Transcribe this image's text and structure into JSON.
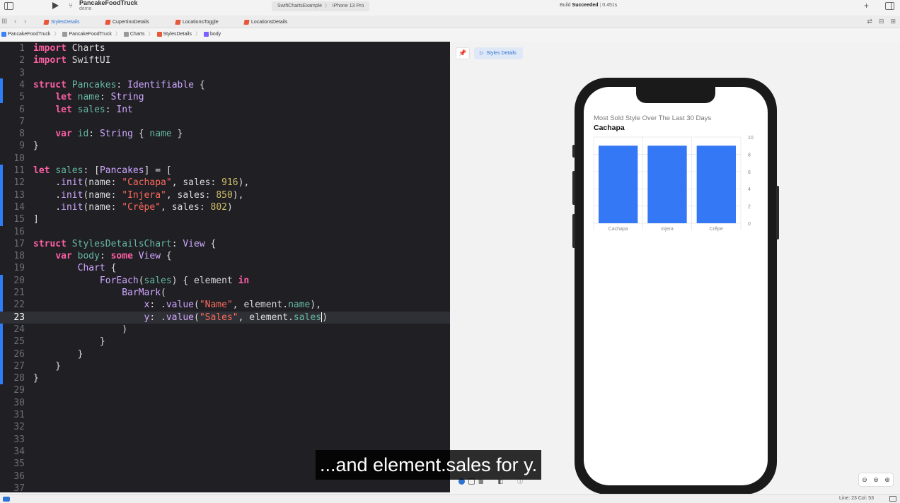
{
  "titlebar": {
    "project": "PancakeFoodTruck",
    "branch": "demo",
    "scheme": "SwiftChartsExample",
    "device": "iPhone 13 Pro",
    "build_status_prefix": "Build",
    "build_status": "Succeeded",
    "build_time": "0.451s"
  },
  "tabs": [
    {
      "label": "StylesDetails",
      "active": true
    },
    {
      "label": "CupertinoDetails",
      "active": false
    },
    {
      "label": "LocationsToggle",
      "active": false
    },
    {
      "label": "LocationsDetails",
      "active": false
    }
  ],
  "breadcrumb": [
    "PancakeFoodTruck",
    "PancakeFoodTruck",
    "Charts",
    "StylesDetails",
    "body"
  ],
  "editor": {
    "current_line": 23,
    "lines": [
      [
        [
          "kw",
          "import"
        ],
        [
          "pl",
          " Charts"
        ]
      ],
      [
        [
          "kw",
          "import"
        ],
        [
          "pl",
          " SwiftUI"
        ]
      ],
      [],
      [
        [
          "kw",
          "struct"
        ],
        [
          "pl",
          " "
        ],
        [
          "nm",
          "Pancakes"
        ],
        [
          "pl",
          ": "
        ],
        [
          "ty",
          "Identifiable"
        ],
        [
          "pl",
          " {"
        ]
      ],
      [
        [
          "pl",
          "    "
        ],
        [
          "kw",
          "let"
        ],
        [
          "pl",
          " "
        ],
        [
          "nm",
          "name"
        ],
        [
          "pl",
          ": "
        ],
        [
          "ty",
          "String"
        ]
      ],
      [
        [
          "pl",
          "    "
        ],
        [
          "kw",
          "let"
        ],
        [
          "pl",
          " "
        ],
        [
          "nm",
          "sales"
        ],
        [
          "pl",
          ": "
        ],
        [
          "ty",
          "Int"
        ]
      ],
      [],
      [
        [
          "pl",
          "    "
        ],
        [
          "kw",
          "var"
        ],
        [
          "pl",
          " "
        ],
        [
          "nm",
          "id"
        ],
        [
          "pl",
          ": "
        ],
        [
          "ty",
          "String"
        ],
        [
          "pl",
          " { "
        ],
        [
          "nm",
          "name"
        ],
        [
          "pl",
          " }"
        ]
      ],
      [
        [
          "pl",
          "}"
        ]
      ],
      [],
      [
        [
          "kw",
          "let"
        ],
        [
          "pl",
          " "
        ],
        [
          "nm",
          "sales"
        ],
        [
          "pl",
          ": ["
        ],
        [
          "ty",
          "Pancakes"
        ],
        [
          "pl",
          "] = ["
        ]
      ],
      [
        [
          "pl",
          "    ."
        ],
        [
          "ty",
          "init"
        ],
        [
          "pl",
          "(name: "
        ],
        [
          "st",
          "\"Cachapa\""
        ],
        [
          "pl",
          ", sales: "
        ],
        [
          "nu",
          "916"
        ],
        [
          "pl",
          "),"
        ]
      ],
      [
        [
          "pl",
          "    ."
        ],
        [
          "ty",
          "init"
        ],
        [
          "pl",
          "(name: "
        ],
        [
          "st",
          "\"Injera\""
        ],
        [
          "pl",
          ", sales: "
        ],
        [
          "nu",
          "850"
        ],
        [
          "pl",
          "),"
        ]
      ],
      [
        [
          "pl",
          "    ."
        ],
        [
          "ty",
          "init"
        ],
        [
          "pl",
          "(name: "
        ],
        [
          "st",
          "\"Crêpe\""
        ],
        [
          "pl",
          ", sales: "
        ],
        [
          "nu",
          "802"
        ],
        [
          "pl",
          ")"
        ]
      ],
      [
        [
          "pl",
          "]"
        ]
      ],
      [],
      [
        [
          "kw",
          "struct"
        ],
        [
          "pl",
          " "
        ],
        [
          "nm",
          "StylesDetailsChart"
        ],
        [
          "pl",
          ": "
        ],
        [
          "ty",
          "View"
        ],
        [
          "pl",
          " {"
        ]
      ],
      [
        [
          "pl",
          "    "
        ],
        [
          "kw",
          "var"
        ],
        [
          "pl",
          " "
        ],
        [
          "nm",
          "body"
        ],
        [
          "pl",
          ": "
        ],
        [
          "kw",
          "some"
        ],
        [
          "pl",
          " "
        ],
        [
          "ty",
          "View"
        ],
        [
          "pl",
          " {"
        ]
      ],
      [
        [
          "pl",
          "        "
        ],
        [
          "ty",
          "Chart"
        ],
        [
          "pl",
          " {"
        ]
      ],
      [
        [
          "pl",
          "            "
        ],
        [
          "ty",
          "ForEach"
        ],
        [
          "pl",
          "("
        ],
        [
          "nm",
          "sales"
        ],
        [
          "pl",
          ") { element "
        ],
        [
          "kw",
          "in"
        ]
      ],
      [
        [
          "pl",
          "                "
        ],
        [
          "ty",
          "BarMark"
        ],
        [
          "pl",
          "("
        ]
      ],
      [
        [
          "pl",
          "                    "
        ],
        [
          "ty",
          "x"
        ],
        [
          "pl",
          ": ."
        ],
        [
          "ty",
          "value"
        ],
        [
          "pl",
          "("
        ],
        [
          "st",
          "\"Name\""
        ],
        [
          "pl",
          ", element."
        ],
        [
          "nm",
          "name"
        ],
        [
          "pl",
          "),"
        ]
      ],
      [
        [
          "pl",
          "                    "
        ],
        [
          "ty",
          "y"
        ],
        [
          "pl",
          ": ."
        ],
        [
          "ty",
          "value"
        ],
        [
          "pl",
          "("
        ],
        [
          "st",
          "\"Sales\""
        ],
        [
          "pl",
          ", element."
        ],
        [
          "nm",
          "sales"
        ],
        [
          "pl",
          ")"
        ]
      ],
      [
        [
          "pl",
          "                )"
        ]
      ],
      [
        [
          "pl",
          "            }"
        ]
      ],
      [
        [
          "pl",
          "        }"
        ]
      ],
      [
        [
          "pl",
          "    }"
        ]
      ],
      [
        [
          "pl",
          "}"
        ]
      ],
      [],
      [],
      [],
      [],
      [],
      [],
      [],
      [],
      []
    ]
  },
  "preview": {
    "tab_label": "Styles Details",
    "chart_subtitle": "Most Sold Style Over The Last 30 Days",
    "chart_heading": "Cachapa"
  },
  "chart_data": {
    "type": "bar",
    "categories": [
      "Cachapa",
      "Injera",
      "Crêpe"
    ],
    "values": [
      9,
      9,
      9
    ],
    "ylim": [
      0,
      10
    ],
    "yticks": [
      0,
      2,
      4,
      6,
      8,
      10
    ],
    "grid": true,
    "bar_color": "#3478f6"
  },
  "statusbar": {
    "position": "Line: 23  Col: 53"
  },
  "subtitle": "...and element.sales for y."
}
